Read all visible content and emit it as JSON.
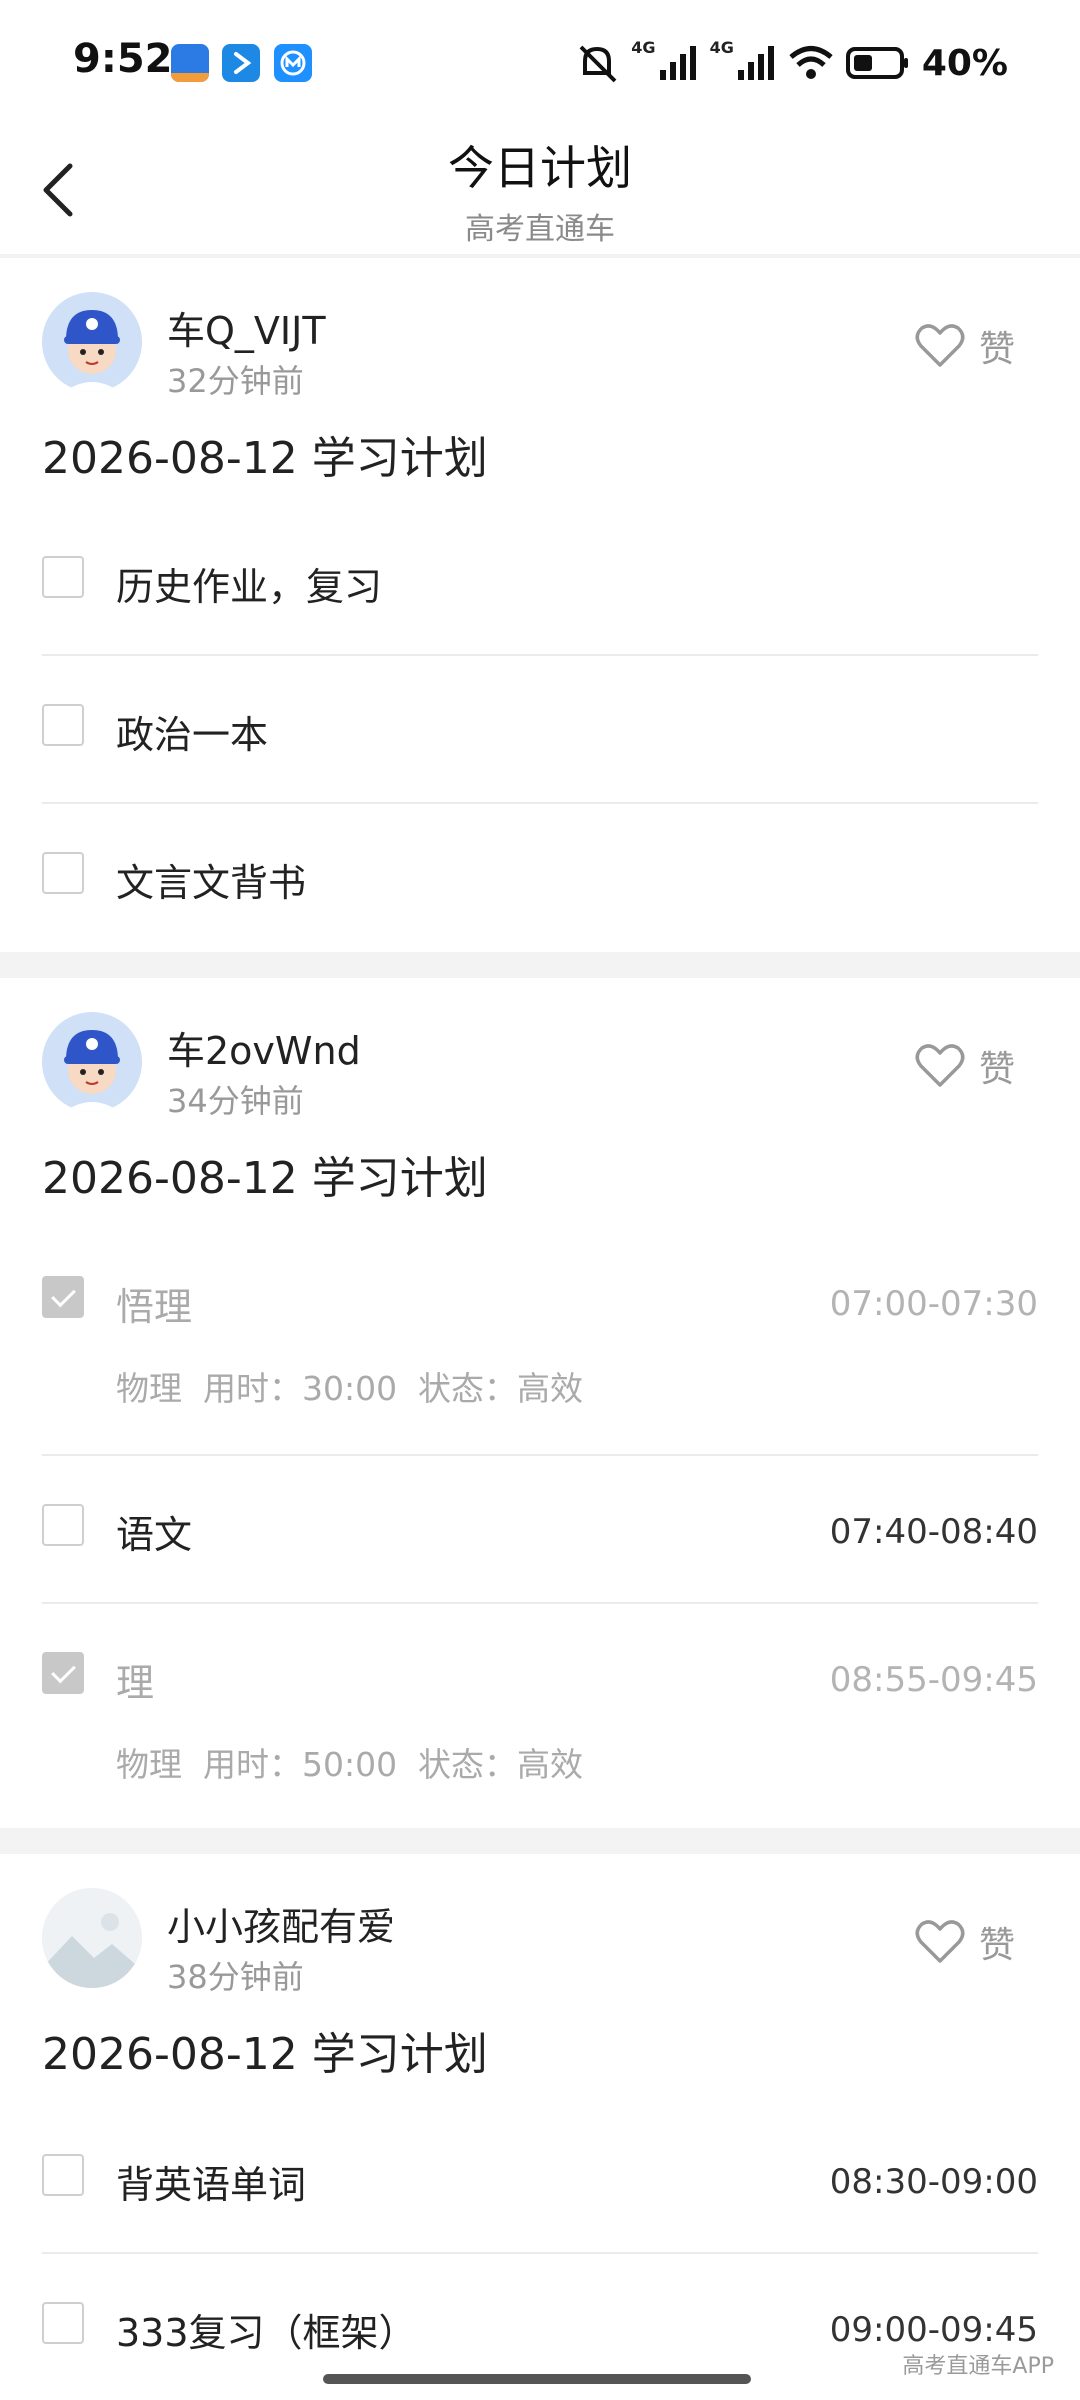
{
  "status_bar": {
    "time": "9:52",
    "signal_1": "4G",
    "signal_2": "4G",
    "battery": "40%",
    "icons": [
      "gaokao-app-icon",
      "bluetooth-app-icon",
      "metro-app-icon",
      "mute-icon",
      "signal-icon",
      "signal-icon",
      "wifi-icon",
      "battery-icon"
    ]
  },
  "header": {
    "title": "今日计划",
    "subtitle": "高考直通车",
    "back_icon": "chevron-left-icon"
  },
  "posts": [
    {
      "user": "车Q_VIJT",
      "time": "32分钟前",
      "like_label": "赞",
      "plan_title": "2026-08-12 学习计划",
      "tasks": [
        {
          "name": "历史作业，复习",
          "checked": false
        },
        {
          "name": "政治一本",
          "checked": false
        },
        {
          "name": "文言文背书",
          "checked": false
        }
      ]
    },
    {
      "user": "车2ovWnd",
      "time": "34分钟前",
      "like_label": "赞",
      "plan_title": "2026-08-12 学习计划",
      "tasks": [
        {
          "name": "悟理",
          "checked": true,
          "time": "07:00-07:30",
          "meta": "物理  用时：30:00  状态：高效"
        },
        {
          "name": "语文",
          "checked": false,
          "time": "07:40-08:40"
        },
        {
          "name": "理",
          "checked": true,
          "time": "08:55-09:45",
          "meta": "物理  用时：50:00  状态：高效"
        }
      ]
    },
    {
      "user": "小小孩配有爱",
      "time": "38分钟前",
      "like_label": "赞",
      "plan_title": "2026-08-12 学习计划",
      "tasks": [
        {
          "name": "背英语单词",
          "checked": false,
          "time": "08:30-09:00"
        },
        {
          "name": "333复习（框架）",
          "checked": false,
          "time": "09:00-09:45"
        }
      ]
    }
  ],
  "watermark": "高考直通车APP",
  "colors": {
    "checked": "#c8c8c8",
    "muted": "#999999",
    "divider": "#f3f3f3"
  }
}
